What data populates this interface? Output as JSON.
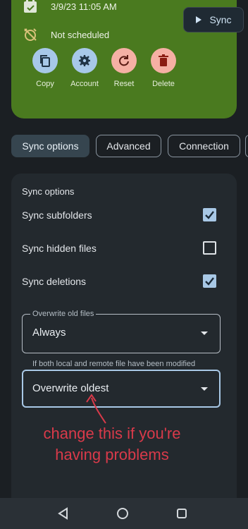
{
  "status": {
    "last_sync": "3/9/23 11:05 AM",
    "schedule": "Not scheduled",
    "sync_button": "Sync"
  },
  "actions": [
    {
      "label": "Copy",
      "icon": "copy-icon",
      "color": "#a7c8e8"
    },
    {
      "label": "Account",
      "icon": "gear-icon",
      "color": "#a7c8e8"
    },
    {
      "label": "Reset",
      "icon": "reset-icon",
      "color": "#f5b0a4"
    },
    {
      "label": "Delete",
      "icon": "trash-icon",
      "color": "#f5b0a4"
    }
  ],
  "tabs": [
    "Sync options",
    "Advanced",
    "Connection"
  ],
  "panel": {
    "title": "Sync options",
    "options": [
      {
        "label": "Sync subfolders",
        "checked": true
      },
      {
        "label": "Sync hidden files",
        "checked": false
      },
      {
        "label": "Sync deletions",
        "checked": true
      }
    ],
    "overwrite": {
      "label": "Overwrite old files",
      "value": "Always"
    },
    "conflict": {
      "label": "If both local and remote file have been modified",
      "value": "Overwrite oldest"
    }
  },
  "annotation": {
    "line1": "change this if you're",
    "line2": "having problems",
    "color": "#d93a4a"
  },
  "colors": {
    "card": "#4a7a1f",
    "accent": "#a8c8e6",
    "background": "#1b1f23"
  }
}
